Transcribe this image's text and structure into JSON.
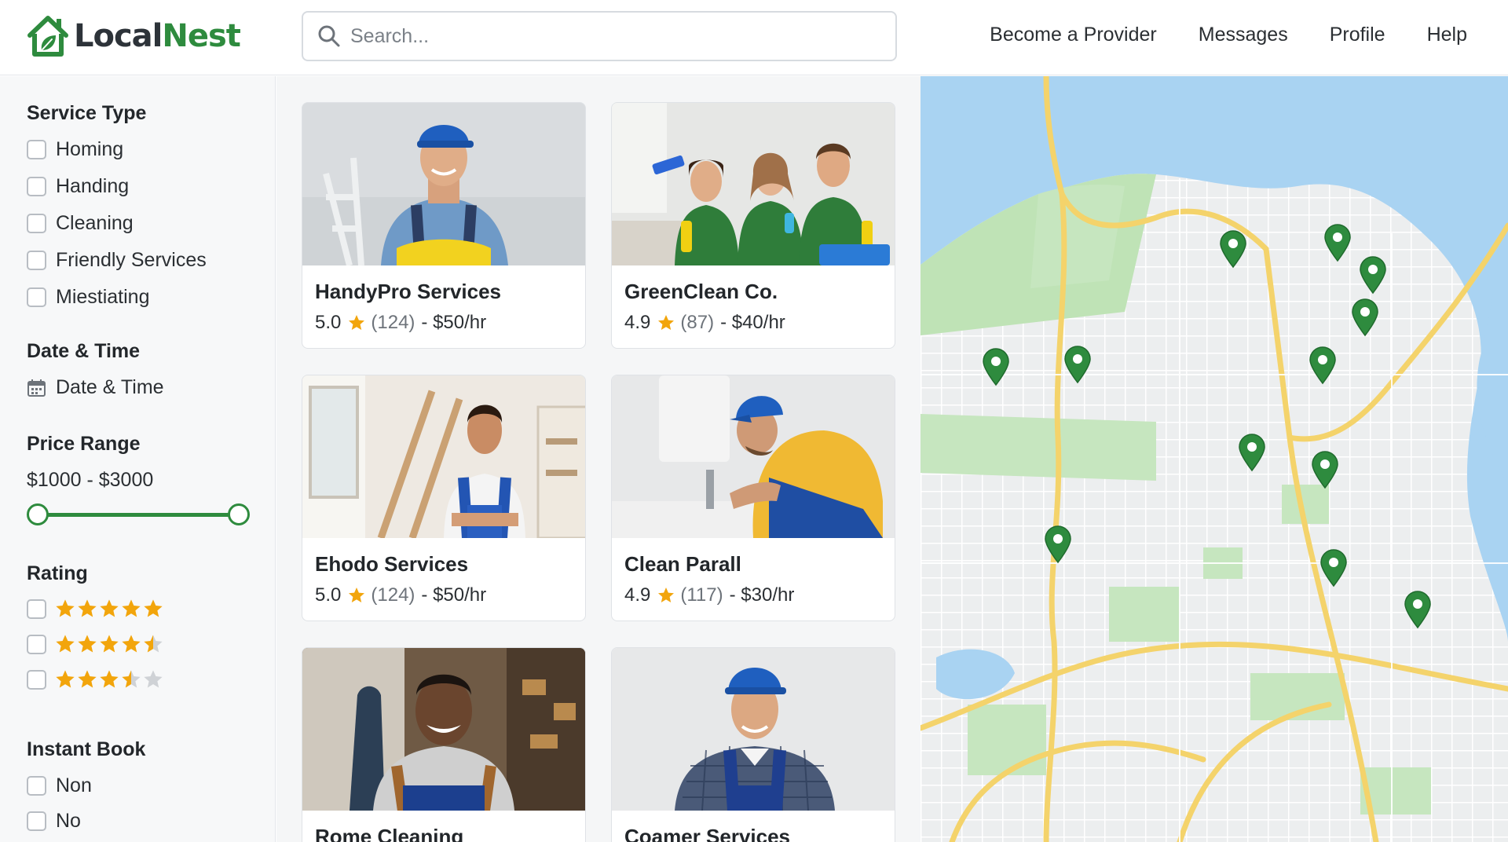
{
  "app": {
    "brand_part1": "Local",
    "brand_part2": "Nest"
  },
  "search": {
    "placeholder": "Search..."
  },
  "nav": [
    "Become a Provider",
    "Messages",
    "Profile",
    "Help"
  ],
  "filters": {
    "service_type": {
      "title": "Service Type",
      "options": [
        "Homing",
        "Handing",
        "Cleaning",
        "Friendly Services",
        "Miestiating"
      ]
    },
    "date_time": {
      "title": "Date & Time",
      "picker_label": "Date & Time"
    },
    "price_range": {
      "title": "Price Range",
      "value": "$1000 - $3000"
    },
    "rating": {
      "title": "Rating",
      "options": [
        5,
        4.5,
        3.5
      ]
    },
    "instant_book": {
      "title": "Instant Book",
      "options": [
        "Non",
        "No"
      ]
    }
  },
  "providers": [
    {
      "name": "HandyPro Services",
      "rating": "5.0",
      "reviews": "(124)",
      "sep": "-",
      "price": "$50/hr"
    },
    {
      "name": "GreenClean Co.",
      "rating": "4.9",
      "reviews": "(87)",
      "sep": "-",
      "price": "$40/hr"
    },
    {
      "name": "Ehodo Services",
      "rating": "5.0",
      "reviews": "(124)",
      "sep": "-",
      "price": "$50/hr"
    },
    {
      "name": "Clean Parall",
      "rating": "4.9",
      "reviews": "(117)",
      "sep": "-",
      "price": "$30/hr"
    },
    {
      "name": "Rome Cleaning",
      "rating": "",
      "reviews": "",
      "sep": "",
      "price": ""
    },
    {
      "name": "Coamer Services",
      "rating": "",
      "reviews": "",
      "sep": "",
      "price": ""
    }
  ],
  "colors": {
    "brand_green": "#2e8b3e",
    "star": "#f2a50c",
    "water": "#a9d3f2",
    "land": "#eceeef",
    "park": "#c6e6bf",
    "road": "#f4d36b"
  },
  "icons": [
    "house-leaf-logo-icon",
    "search-icon",
    "calendar-icon",
    "star-icon",
    "map-pin-icon"
  ]
}
